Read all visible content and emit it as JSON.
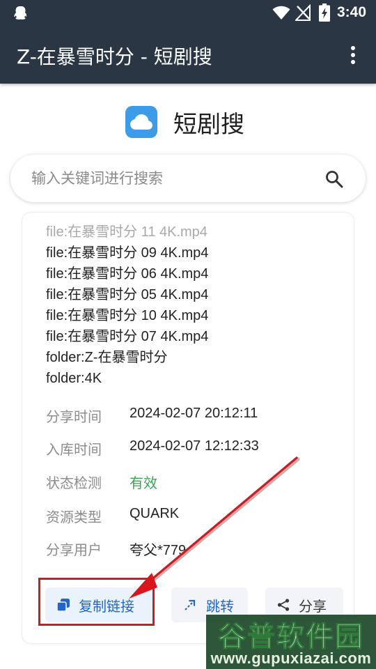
{
  "status_bar": {
    "time": "3:40",
    "icons": [
      "bird-icon",
      "wifi-icon",
      "no-signal-icon",
      "battery-charging-icon"
    ]
  },
  "app_bar": {
    "title": "Z-在暴雪时分 - 短剧搜",
    "menu_icon": "more-vertical-icon"
  },
  "brand": {
    "name": "短剧搜",
    "logo_icon": "cloud-icon"
  },
  "search": {
    "placeholder": "输入关键词进行搜索",
    "value": "",
    "icon": "search-icon"
  },
  "result": {
    "files": [
      "file:在暴雪时分 11 4K.mp4",
      "file:在暴雪时分 09 4K.mp4",
      "file:在暴雪时分 06 4K.mp4",
      "file:在暴雪时分 05 4K.mp4",
      "file:在暴雪时分 10 4K.mp4",
      "file:在暴雪时分 07 4K.mp4",
      "folder:Z-在暴雪时分",
      "folder:4K"
    ],
    "meta": [
      {
        "label": "分享时间",
        "value": "2024-02-07 20:12:11"
      },
      {
        "label": "入库时间",
        "value": "2024-02-07 12:12:33"
      },
      {
        "label": "状态检测",
        "value": "有效"
      },
      {
        "label": "资源类型",
        "value": "QUARK"
      },
      {
        "label": "分享用户",
        "value": "夸父*779"
      }
    ],
    "actions": {
      "copy": "复制链接",
      "jump": "跳转",
      "share": "分享"
    }
  },
  "colors": {
    "app_bar": "#2b3645",
    "accent_blue": "#2266cc",
    "status_valid": "#3aa653",
    "annotation_red": "#d9161d",
    "brand_logo": "#3e9be8"
  },
  "watermark": {
    "logo_text": "谷普软件园",
    "url": "www.gupuxiazai.com"
  }
}
